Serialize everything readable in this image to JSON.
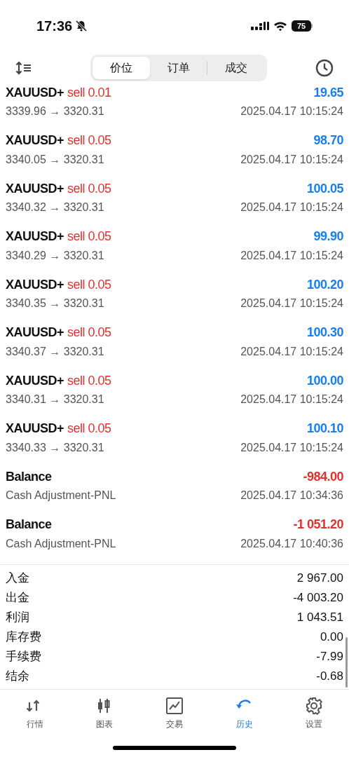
{
  "status_bar": {
    "time": "17:36",
    "battery": "75"
  },
  "tabs": [
    {
      "label": "价位",
      "selected": true
    },
    {
      "label": "订单",
      "selected": false
    },
    {
      "label": "成交",
      "selected": false
    }
  ],
  "entries": [
    {
      "kind": "trade",
      "symbol": "XAUUSD+",
      "side": "sell 0.01",
      "detail": "3339.96 → 3320.31",
      "amount": "19.65",
      "color": "#1a7ee6",
      "time": "2025.04.17 10:15:24"
    },
    {
      "kind": "trade",
      "symbol": "XAUUSD+",
      "side": "sell 0.05",
      "detail": "3340.05 → 3320.31",
      "amount": "98.70",
      "color": "#1a7ee6",
      "time": "2025.04.17 10:15:24"
    },
    {
      "kind": "trade",
      "symbol": "XAUUSD+",
      "side": "sell 0.05",
      "detail": "3340.32 → 3320.31",
      "amount": "100.05",
      "color": "#1a7ee6",
      "time": "2025.04.17 10:15:24"
    },
    {
      "kind": "trade",
      "symbol": "XAUUSD+",
      "side": "sell 0.05",
      "detail": "3340.29 → 3320.31",
      "amount": "99.90",
      "color": "#1a7ee6",
      "time": "2025.04.17 10:15:24"
    },
    {
      "kind": "trade",
      "symbol": "XAUUSD+",
      "side": "sell 0.05",
      "detail": "3340.35 → 3320.31",
      "amount": "100.20",
      "color": "#1a7ee6",
      "time": "2025.04.17 10:15:24"
    },
    {
      "kind": "trade",
      "symbol": "XAUUSD+",
      "side": "sell 0.05",
      "detail": "3340.37 → 3320.31",
      "amount": "100.30",
      "color": "#1a7ee6",
      "time": "2025.04.17 10:15:24"
    },
    {
      "kind": "trade",
      "symbol": "XAUUSD+",
      "side": "sell 0.05",
      "detail": "3340.31 → 3320.31",
      "amount": "100.00",
      "color": "#1a7ee6",
      "time": "2025.04.17 10:15:24"
    },
    {
      "kind": "trade",
      "symbol": "XAUUSD+",
      "side": "sell 0.05",
      "detail": "3340.33 → 3320.31",
      "amount": "100.10",
      "color": "#1a7ee6",
      "time": "2025.04.17 10:15:24"
    },
    {
      "kind": "balance",
      "symbol": "Balance",
      "detail": "Cash Adjustment-PNL",
      "amount": "-984.00",
      "color": "#e0312e",
      "time": "2025.04.17 10:34:36"
    },
    {
      "kind": "balance",
      "symbol": "Balance",
      "detail": "Cash Adjustment-PNL",
      "amount": "-1 051.20",
      "color": "#e0312e",
      "time": "2025.04.17 10:40:36"
    }
  ],
  "summary": [
    {
      "label": "入金",
      "value": "2 967.00"
    },
    {
      "label": "出金",
      "value": "-4 003.20"
    },
    {
      "label": "利润",
      "value": "1 043.51"
    },
    {
      "label": "库存费",
      "value": "0.00"
    },
    {
      "label": "手续费",
      "value": "-7.99"
    },
    {
      "label": "结余",
      "value": "-0.68"
    }
  ],
  "nav": [
    {
      "kind": "quotes",
      "label": "行情",
      "selected": false
    },
    {
      "kind": "chart",
      "label": "图表",
      "selected": false
    },
    {
      "kind": "trade",
      "label": "交易",
      "selected": false
    },
    {
      "kind": "history",
      "label": "历史",
      "selected": true
    },
    {
      "kind": "settings",
      "label": "设置",
      "selected": false
    }
  ]
}
